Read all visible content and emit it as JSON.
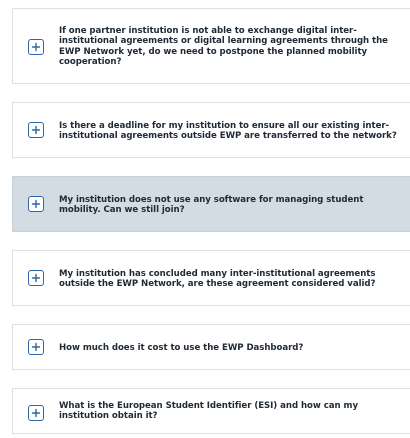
{
  "faq": {
    "items": [
      {
        "question": "If one partner institution is not able to exchange digital inter-institutional agreements or digital learning agreements through the EWP Network yet, do we need to postpone the planned mobility cooperation?",
        "toggle_icon": "plus-icon",
        "highlighted": false
      },
      {
        "question": "Is there a deadline for my institution to ensure all our existing inter-institutional agreements outside EWP are transferred to the network?",
        "toggle_icon": "plus-icon",
        "highlighted": false
      },
      {
        "question": "My institution does not use any software for managing student mobility. Can we still join?",
        "toggle_icon": "plus-icon",
        "highlighted": true
      },
      {
        "question": "My institution has concluded many inter-institutional agreements outside the EWP Network, are these agreement considered valid?",
        "toggle_icon": "plus-icon",
        "highlighted": false
      },
      {
        "question": "How much does it cost to use the EWP Dashboard?",
        "toggle_icon": "plus-icon",
        "highlighted": false
      },
      {
        "question": "What is the European Student Identifier (ESI) and how can my institution obtain it?",
        "toggle_icon": "plus-icon",
        "highlighted": false
      }
    ]
  },
  "colors": {
    "accent": "#2f67a6",
    "highlight_bg": "#d3dbe3",
    "border": "#dde1e6",
    "text": "#1f2a35"
  }
}
